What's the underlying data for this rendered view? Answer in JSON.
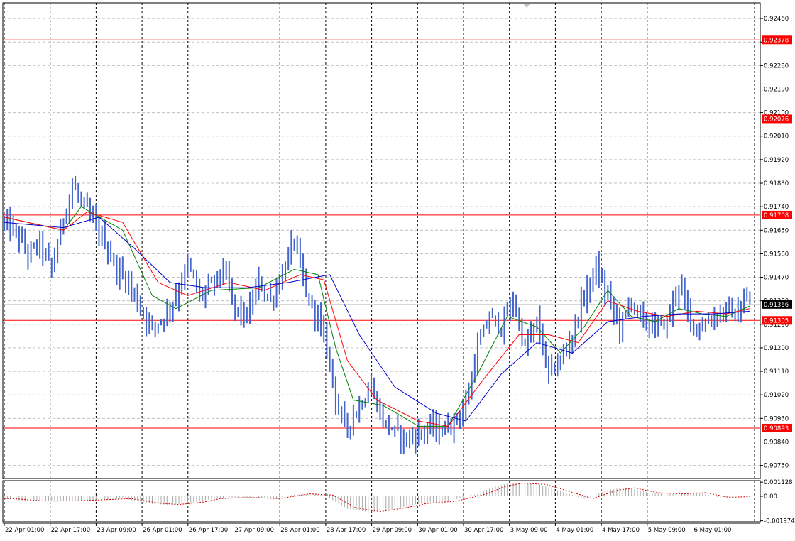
{
  "chart_data": {
    "type": "line",
    "instrument_style": "bars",
    "title": "",
    "xlabel": "",
    "ylabel": "",
    "price_ylim": [
      0.907,
      0.9252
    ],
    "price_ticks": [
      0.9246,
      0.9237,
      0.9228,
      0.9219,
      0.921,
      0.9201,
      0.9192,
      0.9183,
      0.9174,
      0.9165,
      0.9156,
      0.9147,
      0.9138,
      0.9129,
      0.912,
      0.9111,
      0.9102,
      0.9093,
      0.9084,
      0.9075
    ],
    "price_tick_labels": [
      "0.92460",
      "0.92370",
      "0.92280",
      "0.92190",
      "0.92100",
      "0.92010",
      "0.91920",
      "0.91830",
      "0.91740",
      "0.91650",
      "0.91560",
      "0.91470",
      "0.91380",
      "0.91290",
      "0.91200",
      "0.91110",
      "0.91020",
      "0.90930",
      "0.90840",
      "0.90750"
    ],
    "x_labels": [
      "22 Apr 01:00",
      "22 Apr 17:00",
      "23 Apr 09:00",
      "26 Apr 01:00",
      "26 Apr 17:00",
      "27 Apr 09:00",
      "28 Apr 01:00",
      "28 Apr 17:00",
      "29 Apr 09:00",
      "30 Apr 01:00",
      "30 Apr 17:00",
      "3 May 09:00",
      "4 May 01:00",
      "4 May 17:00",
      "5 May 09:00",
      "6 May 01:00"
    ],
    "levels": [
      {
        "value": 0.92378,
        "label": "0.92378"
      },
      {
        "value": 0.92076,
        "label": "0.92076"
      },
      {
        "value": 0.91708,
        "label": "0.91708"
      },
      {
        "value": 0.91305,
        "label": "0.91305"
      },
      {
        "value": 0.90893,
        "label": "0.90893"
      }
    ],
    "current_price": {
      "value": 0.91366,
      "label": "0.91366"
    },
    "close_path": [
      [
        0,
        0.9168
      ],
      [
        4,
        0.9164
      ],
      [
        8,
        0.9156
      ],
      [
        12,
        0.916
      ],
      [
        16,
        0.915
      ],
      [
        20,
        0.917
      ],
      [
        23,
        0.9182
      ],
      [
        26,
        0.9176
      ],
      [
        30,
        0.9168
      ],
      [
        34,
        0.916
      ],
      [
        38,
        0.915
      ],
      [
        42,
        0.9145
      ],
      [
        46,
        0.9135
      ],
      [
        50,
        0.9128
      ],
      [
        54,
        0.9132
      ],
      [
        58,
        0.914
      ],
      [
        62,
        0.9152
      ],
      [
        66,
        0.914
      ],
      [
        70,
        0.9144
      ],
      [
        74,
        0.915
      ],
      [
        78,
        0.9135
      ],
      [
        82,
        0.9132
      ],
      [
        86,
        0.9145
      ],
      [
        90,
        0.9138
      ],
      [
        94,
        0.9148
      ],
      [
        98,
        0.9162
      ],
      [
        102,
        0.914
      ],
      [
        106,
        0.9132
      ],
      [
        110,
        0.9115
      ],
      [
        113,
        0.9095
      ],
      [
        116,
        0.909
      ],
      [
        120,
        0.9098
      ],
      [
        124,
        0.9105
      ],
      [
        128,
        0.9092
      ],
      [
        132,
        0.9088
      ],
      [
        136,
        0.9085
      ],
      [
        140,
        0.9087
      ],
      [
        144,
        0.909
      ],
      [
        148,
        0.9088
      ],
      [
        152,
        0.9092
      ],
      [
        156,
        0.9098
      ],
      [
        160,
        0.912
      ],
      [
        164,
        0.9132
      ],
      [
        168,
        0.9128
      ],
      [
        172,
        0.9138
      ],
      [
        176,
        0.912
      ],
      [
        180,
        0.913
      ],
      [
        184,
        0.911
      ],
      [
        188,
        0.9115
      ],
      [
        192,
        0.9125
      ],
      [
        196,
        0.914
      ],
      [
        200,
        0.915
      ],
      [
        204,
        0.914
      ],
      [
        208,
        0.9128
      ],
      [
        212,
        0.9138
      ],
      [
        216,
        0.913
      ],
      [
        220,
        0.9128
      ],
      [
        224,
        0.913
      ],
      [
        228,
        0.9145
      ],
      [
        232,
        0.913
      ],
      [
        236,
        0.9128
      ],
      [
        240,
        0.9132
      ],
      [
        244,
        0.9135
      ],
      [
        248,
        0.9132
      ],
      [
        250,
        0.9138
      ],
      [
        252,
        0.9137
      ]
    ],
    "series": [
      {
        "color": "#008000",
        "values": [
          [
            0,
            0.917
          ],
          [
            20,
            0.9165
          ],
          [
            26,
            0.9174
          ],
          [
            40,
            0.9165
          ],
          [
            50,
            0.914
          ],
          [
            58,
            0.9135
          ],
          [
            70,
            0.9142
          ],
          [
            86,
            0.9143
          ],
          [
            98,
            0.915
          ],
          [
            106,
            0.9148
          ],
          [
            112,
            0.912
          ],
          [
            118,
            0.91
          ],
          [
            128,
            0.9098
          ],
          [
            140,
            0.909
          ],
          [
            150,
            0.909
          ],
          [
            160,
            0.911
          ],
          [
            170,
            0.9132
          ],
          [
            180,
            0.9128
          ],
          [
            188,
            0.9118
          ],
          [
            196,
            0.9128
          ],
          [
            204,
            0.9142
          ],
          [
            212,
            0.9132
          ],
          [
            220,
            0.913
          ],
          [
            228,
            0.9135
          ],
          [
            236,
            0.9133
          ],
          [
            244,
            0.9132
          ],
          [
            252,
            0.9136
          ]
        ]
      },
      {
        "color": "#ff0000",
        "values": [
          [
            0,
            0.917
          ],
          [
            20,
            0.9165
          ],
          [
            28,
            0.9172
          ],
          [
            40,
            0.9168
          ],
          [
            52,
            0.9145
          ],
          [
            62,
            0.914
          ],
          [
            76,
            0.9145
          ],
          [
            88,
            0.9142
          ],
          [
            100,
            0.9148
          ],
          [
            108,
            0.9146
          ],
          [
            116,
            0.9115
          ],
          [
            126,
            0.91
          ],
          [
            140,
            0.9092
          ],
          [
            150,
            0.909
          ],
          [
            162,
            0.9108
          ],
          [
            174,
            0.9125
          ],
          [
            184,
            0.9125
          ],
          [
            194,
            0.9122
          ],
          [
            204,
            0.9138
          ],
          [
            214,
            0.9134
          ],
          [
            224,
            0.9132
          ],
          [
            234,
            0.9134
          ],
          [
            244,
            0.9133
          ],
          [
            252,
            0.9135
          ]
        ]
      },
      {
        "color": "#0000cc",
        "values": [
          [
            0,
            0.9168
          ],
          [
            20,
            0.9166
          ],
          [
            32,
            0.917
          ],
          [
            44,
            0.9158
          ],
          [
            56,
            0.9145
          ],
          [
            68,
            0.9143
          ],
          [
            82,
            0.9143
          ],
          [
            96,
            0.9145
          ],
          [
            110,
            0.9148
          ],
          [
            120,
            0.9125
          ],
          [
            132,
            0.9105
          ],
          [
            146,
            0.9095
          ],
          [
            156,
            0.9092
          ],
          [
            168,
            0.911
          ],
          [
            180,
            0.9122
          ],
          [
            192,
            0.9118
          ],
          [
            204,
            0.913
          ],
          [
            216,
            0.9132
          ],
          [
            228,
            0.9133
          ],
          [
            240,
            0.9133
          ],
          [
            252,
            0.9134
          ]
        ]
      }
    ],
    "oscillator": {
      "ylim": [
        -0.00205,
        0.00125
      ],
      "ticks": [
        0.001128,
        0.0,
        -0.001974
      ],
      "tick_labels": [
        "0.001128",
        "0.00",
        "-0.001974"
      ],
      "histogram_color": "#a9a9a9",
      "signal_color": "#d00000",
      "values": [
        [
          0,
          -0.0002
        ],
        [
          10,
          -0.0004
        ],
        [
          20,
          -0.0004
        ],
        [
          30,
          -0.0003
        ],
        [
          40,
          -0.0002
        ],
        [
          50,
          -0.0006
        ],
        [
          56,
          -0.0007
        ],
        [
          64,
          -0.0005
        ],
        [
          70,
          -0.0002
        ],
        [
          80,
          -0.0001
        ],
        [
          90,
          -0.0002
        ],
        [
          100,
          0.0002
        ],
        [
          108,
          0.0001
        ],
        [
          116,
          -0.001
        ],
        [
          124,
          -0.0013
        ],
        [
          132,
          -0.001
        ],
        [
          140,
          -0.0006
        ],
        [
          150,
          -0.0004
        ],
        [
          160,
          0.0002
        ],
        [
          166,
          0.0008
        ],
        [
          172,
          0.0011
        ],
        [
          180,
          0.001
        ],
        [
          188,
          0.0004
        ],
        [
          196,
          -0.0002
        ],
        [
          204,
          0.0005
        ],
        [
          210,
          0.0007
        ],
        [
          218,
          0.0003
        ],
        [
          226,
          0.0002
        ],
        [
          234,
          0.0003
        ],
        [
          242,
          -0.0001
        ],
        [
          252,
          0.0
        ]
      ]
    }
  }
}
